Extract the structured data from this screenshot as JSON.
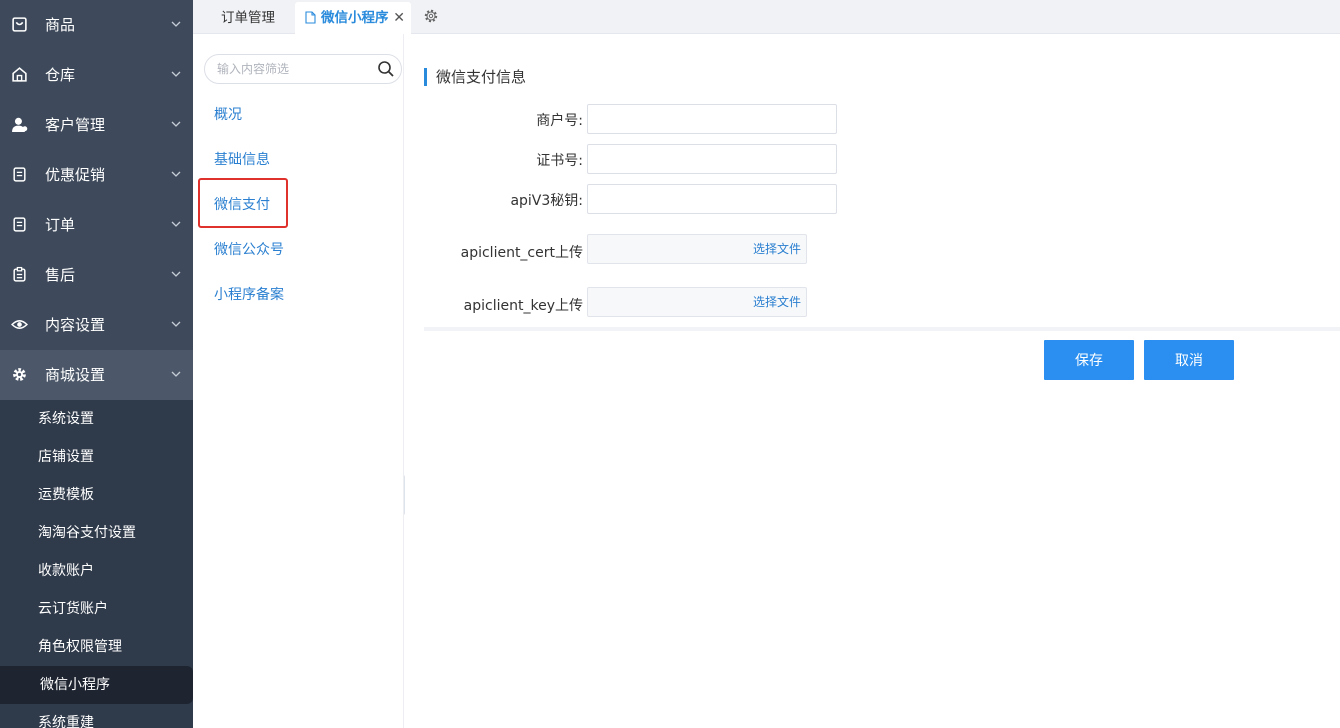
{
  "sidebar": {
    "items": [
      {
        "label": "商品",
        "icon": "product-icon"
      },
      {
        "label": "仓库",
        "icon": "warehouse-icon"
      },
      {
        "label": "客户管理",
        "icon": "user-icon"
      },
      {
        "label": "优惠促销",
        "icon": "promotion-icon"
      },
      {
        "label": "订单",
        "icon": "order-icon"
      },
      {
        "label": "售后",
        "icon": "after-sales-icon"
      },
      {
        "label": "内容设置",
        "icon": "eye-icon"
      },
      {
        "label": "商城设置",
        "icon": "gear-icon"
      }
    ],
    "sub_items": [
      "系统设置",
      "店铺设置",
      "运费模板",
      "淘淘谷支付设置",
      "收款账户",
      "云订货账户",
      "角色权限管理",
      "微信小程序",
      "系统重建"
    ],
    "active_sub": "微信小程序"
  },
  "tabs": {
    "tab1": "订单管理",
    "tab2": "微信小程序",
    "close": "✕"
  },
  "submenu": {
    "filter_placeholder": "输入内容筛选",
    "links": [
      "概况",
      "基础信息",
      "微信支付",
      "微信公众号",
      "小程序备案"
    ],
    "highlighted": "微信支付"
  },
  "form": {
    "section_title": "微信支付信息",
    "merchant_id_label": "商户号:",
    "cert_no_label": "证书号:",
    "apiv3_key_label": "apiV3秘钥:",
    "cert_upload_label": "apiclient_cert上传",
    "key_upload_label": "apiclient_key上传",
    "choose_file": "选择文件",
    "merchant_id_value": "",
    "cert_no_value": "",
    "apiv3_key_value": ""
  },
  "actions": {
    "save": "保存",
    "cancel": "取消"
  },
  "colors": {
    "sidebar_bg": "#2f3a4a",
    "accent": "#2a8ff0",
    "highlight_border": "#e0322d"
  }
}
